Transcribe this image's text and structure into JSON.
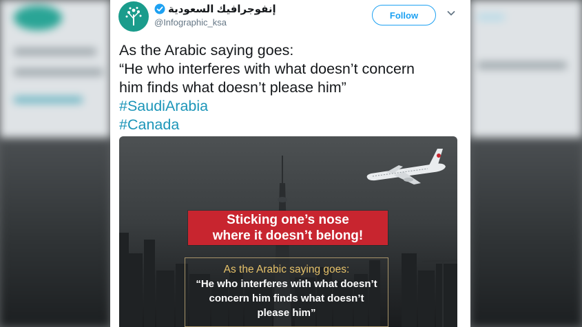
{
  "account": {
    "display_name": "إنفوجرافيك السعودية",
    "handle": "@Infographic_ksa",
    "verified": true,
    "avatar_icon": "infographic-tree-logo",
    "avatar_color": "#1a9c8c"
  },
  "actions": {
    "follow_label": "Follow",
    "more_icon": "chevron-down-icon"
  },
  "tweet": {
    "line1": "As the Arabic saying goes:",
    "line2": "“He who interferes with what doesn’t concern",
    "line3": "him finds what doesn’t please him”",
    "hashtags": [
      "#SaudiArabia",
      "#Canada"
    ]
  },
  "media": {
    "banner_line1": "Sticking one’s nose",
    "banner_line2": "where it doesn’t belong!",
    "quote_title": "As the Arabic saying goes:",
    "quote_line1": "“He who interferes with what doesn’t",
    "quote_line2": "concern him finds what doesn’t",
    "quote_line3": "please him”",
    "banner_color": "#c8252f",
    "quote_title_color": "#e6c26a"
  },
  "colors": {
    "follow_blue": "#1da1f2",
    "hashtag": "#1b95b8"
  }
}
